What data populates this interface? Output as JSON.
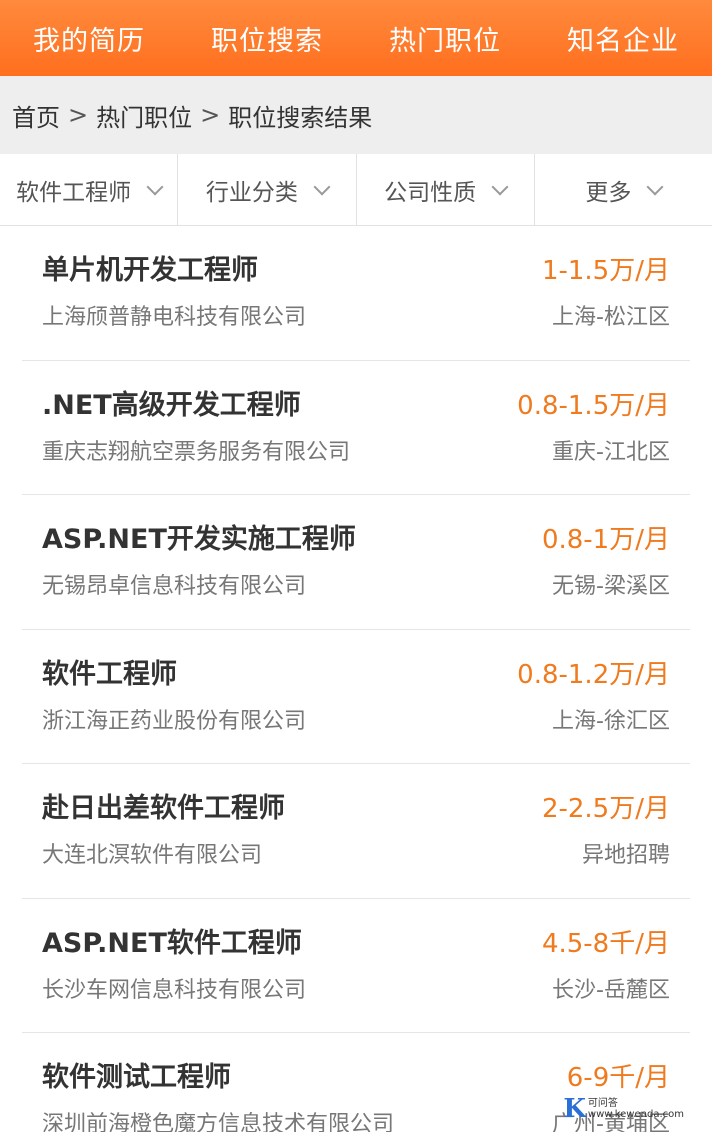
{
  "topnav": {
    "items": [
      "我的简历",
      "职位搜索",
      "热门职位",
      "知名企业"
    ]
  },
  "breadcrumb": {
    "items": [
      "首页",
      "热门职位",
      "职位搜索结果"
    ],
    "separator": ">"
  },
  "filters": {
    "items": [
      "软件工程师",
      "行业分类",
      "公司性质",
      "更多"
    ]
  },
  "jobs": [
    {
      "title": "单片机开发工程师",
      "salary": "1-1.5万/月",
      "company": "上海颀普静电科技有限公司",
      "location": "上海-松江区"
    },
    {
      "title": ".NET高级开发工程师",
      "salary": "0.8-1.5万/月",
      "company": "重庆志翔航空票务服务有限公司",
      "location": "重庆-江北区"
    },
    {
      "title": "ASP.NET开发实施工程师",
      "salary": "0.8-1万/月",
      "company": "无锡昂卓信息科技有限公司",
      "location": "无锡-梁溪区"
    },
    {
      "title": "软件工程师",
      "salary": "0.8-1.2万/月",
      "company": "浙江海正药业股份有限公司",
      "location": "上海-徐汇区"
    },
    {
      "title": "赴日出差软件工程师",
      "salary": "2-2.5万/月",
      "company": "大连北溟软件有限公司",
      "location": "异地招聘"
    },
    {
      "title": "ASP.NET软件工程师",
      "salary": "4.5-8千/月",
      "company": "长沙车网信息科技有限公司",
      "location": "长沙-岳麓区"
    },
    {
      "title": "软件测试工程师",
      "salary": "6-9千/月",
      "company": "深圳前海橙色魔方信息技术有限公司",
      "location": "广州-黄埔区"
    }
  ],
  "watermark": {
    "logo": "K",
    "name": "可问答",
    "url": "www.kewenda.com"
  },
  "colors": {
    "brand": "#ff7a2a",
    "salary": "#f07a1e"
  }
}
